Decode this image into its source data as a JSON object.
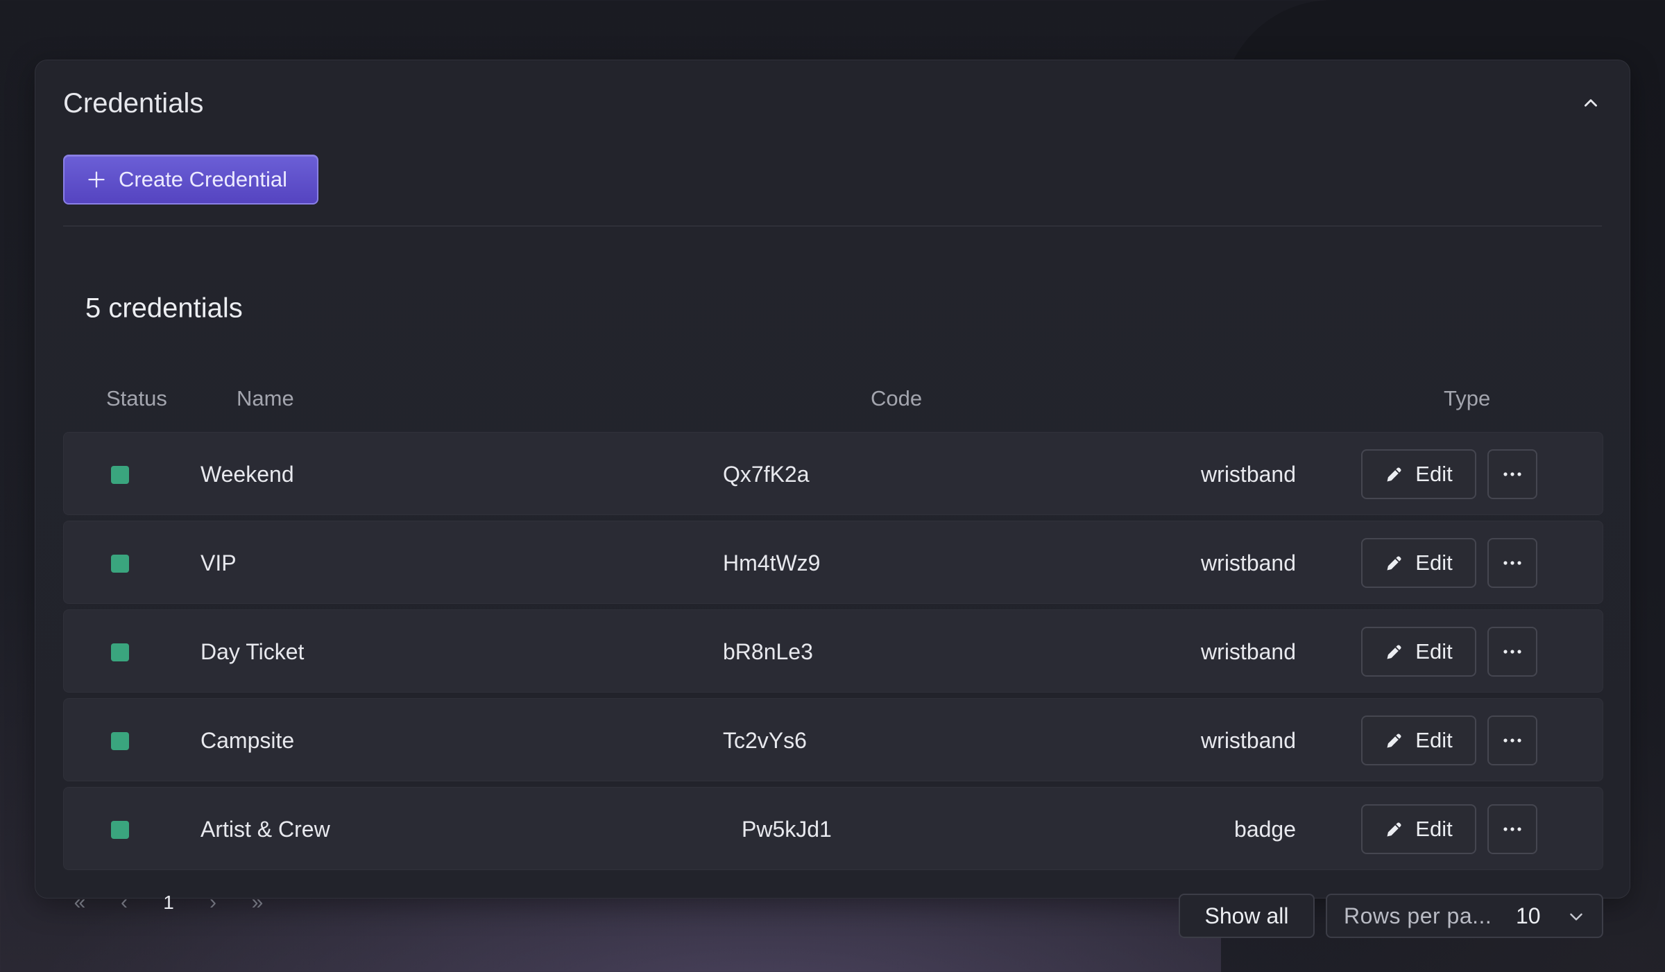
{
  "panel": {
    "title": "Credentials",
    "create_label": "Create Credential"
  },
  "table": {
    "count_label": "5 credentials",
    "columns": {
      "status": "Status",
      "name": "Name",
      "code": "Code",
      "type": "Type"
    },
    "rows": [
      {
        "status": "active",
        "name": "Weekend",
        "code": "Qx7fK2a",
        "type": "wristband"
      },
      {
        "status": "active",
        "name": "VIP",
        "code": "Hm4tWz9",
        "type": "wristband"
      },
      {
        "status": "active",
        "name": "Day Ticket",
        "code": "bR8nLe3",
        "type": "wristband"
      },
      {
        "status": "active",
        "name": "Campsite",
        "code": "Tc2vYs6",
        "type": "wristband"
      },
      {
        "status": "active",
        "name": "Artist & Crew",
        "code": "Pw5kJd1",
        "type": "badge"
      }
    ],
    "edit_label": "Edit"
  },
  "pagination": {
    "first": "«",
    "prev": "‹",
    "current_page": "1",
    "next": "›",
    "last": "»",
    "show_all_label": "Show all",
    "rows_per_page_label": "Rows per pa...",
    "rows_per_page_value": "10"
  },
  "icons": {
    "collapse": "chevron-up-icon",
    "create": "plus-icon",
    "edit": "pencil-icon",
    "more": "ellipsis-icon",
    "rows_select": "chevron-down-icon"
  },
  "colors": {
    "accent": "#5b4bc8",
    "status_active": "#3aa57e"
  }
}
